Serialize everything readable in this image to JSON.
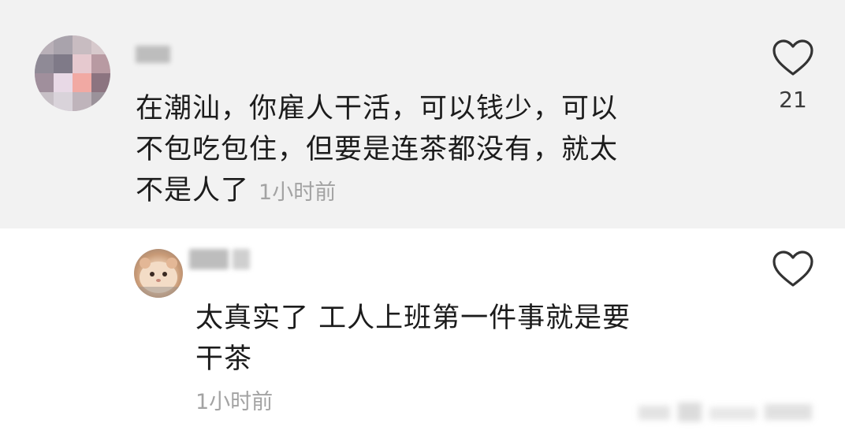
{
  "comments": [
    {
      "username": "",
      "text_lines": [
        "在潮汕，你雇人干活，可以钱少，可以",
        "不包吃包住，但要是连茶都没有，就太",
        "不是人了"
      ],
      "time": "1小时前",
      "likes": "21",
      "like_icon": "heart-outline-icon"
    },
    {
      "username": "",
      "text_lines": [
        "太真实了 工人上班第一件事就是要",
        "干茶"
      ],
      "time": "1小时前",
      "like_icon": "heart-outline-icon"
    }
  ],
  "colors": {
    "top_background": "#f2f2f2",
    "bottom_background": "#ffffff",
    "text": "#1c1c1c",
    "meta": "#a3a3a3"
  }
}
